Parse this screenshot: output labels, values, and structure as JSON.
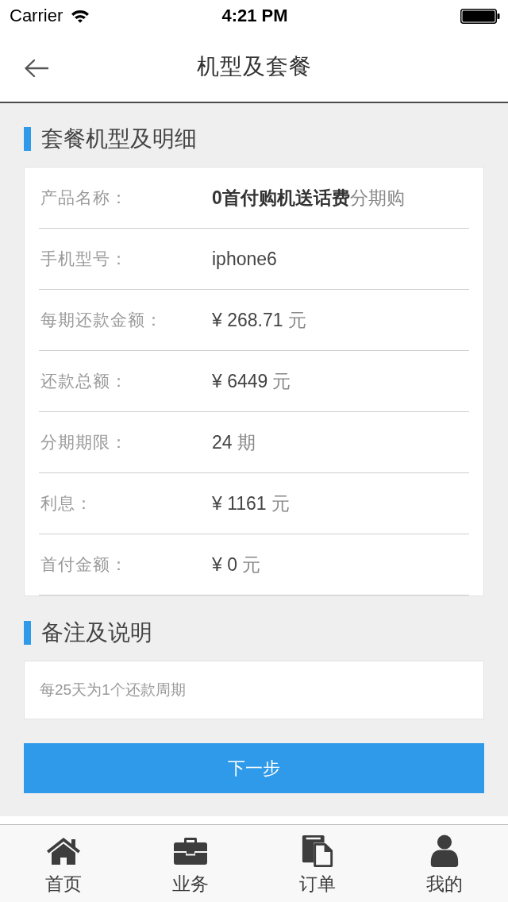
{
  "status_bar": {
    "carrier": "Carrier",
    "time": "4:21 PM"
  },
  "nav_bar": {
    "title": "机型及套餐"
  },
  "details_section": {
    "title": "套餐机型及明细",
    "rows": [
      {
        "label": "产品名称：",
        "value": "0首付购机送话费",
        "unit": "分期购",
        "bold": true
      },
      {
        "label": "手机型号：",
        "value": "iphone6",
        "bold": false
      },
      {
        "label": "每期还款金额：",
        "value": "¥ 268.71",
        "unit": "元",
        "bold": false
      },
      {
        "label": "还款总额：",
        "value": "¥ 6449",
        "unit": "元",
        "bold": false
      },
      {
        "label": "分期期限：",
        "value": "24",
        "unit": "期",
        "bold": false
      },
      {
        "label": "利息：",
        "value": "¥ 1161",
        "unit": "元",
        "bold": false
      },
      {
        "label": "首付金额：",
        "value": "¥ 0",
        "unit": "元",
        "bold": false
      }
    ]
  },
  "notes_section": {
    "title": "备注及说明",
    "text": "每25天为1个还款周期"
  },
  "primary_button": {
    "label": "下一步"
  },
  "tab_bar": {
    "items": [
      {
        "label": "首页",
        "selected": false
      },
      {
        "label": "业务",
        "selected": false
      },
      {
        "label": "订单",
        "selected": false
      },
      {
        "label": "我的",
        "selected": false
      }
    ]
  }
}
